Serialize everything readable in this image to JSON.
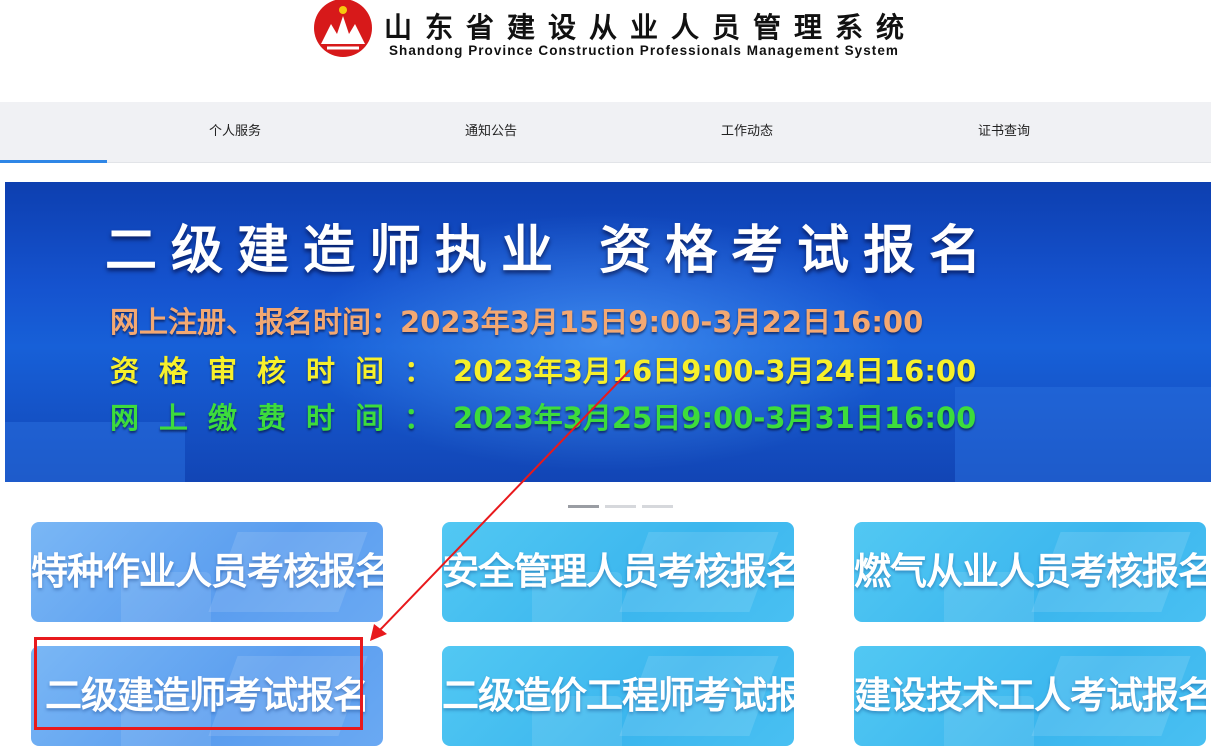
{
  "header": {
    "title_cn": "山东省建设从业人员管理系统",
    "title_en": "Shandong Province Construction Professionals Management System",
    "logo_icon": "shandong-logo-icon"
  },
  "nav": {
    "items": [
      {
        "label": "个人服务"
      },
      {
        "label": "通知公告"
      },
      {
        "label": "工作动态"
      },
      {
        "label": "证书查询"
      }
    ],
    "active_index": 0,
    "accent": "#2f86e6"
  },
  "banner": {
    "title": "二级建造师执业 资格考试报名",
    "line1_label": "网上注册、报名时间：",
    "line1_value": "2023年3月15日9:00-3月22日16:00",
    "line2_label": "资格审核时间：",
    "line2_value": "2023年3月16日9:00-3月24日16:00",
    "line3_label": "网上缴费时间：",
    "line3_value": "2023年3月25日9:00-3月31日16:00",
    "slide_count": 3,
    "active_slide": 0
  },
  "cards": [
    {
      "label": "特种作业人员考核报名"
    },
    {
      "label": "安全管理人员考核报名"
    },
    {
      "label": "燃气从业人员考核报名"
    },
    {
      "label": "二级建造师考试报名"
    },
    {
      "label": "二级造价工程师考试报名"
    },
    {
      "label": "建设技术工人考试报名"
    }
  ],
  "annotation": {
    "highlight_color": "#e8191c",
    "highlighted_card_index": 3
  }
}
